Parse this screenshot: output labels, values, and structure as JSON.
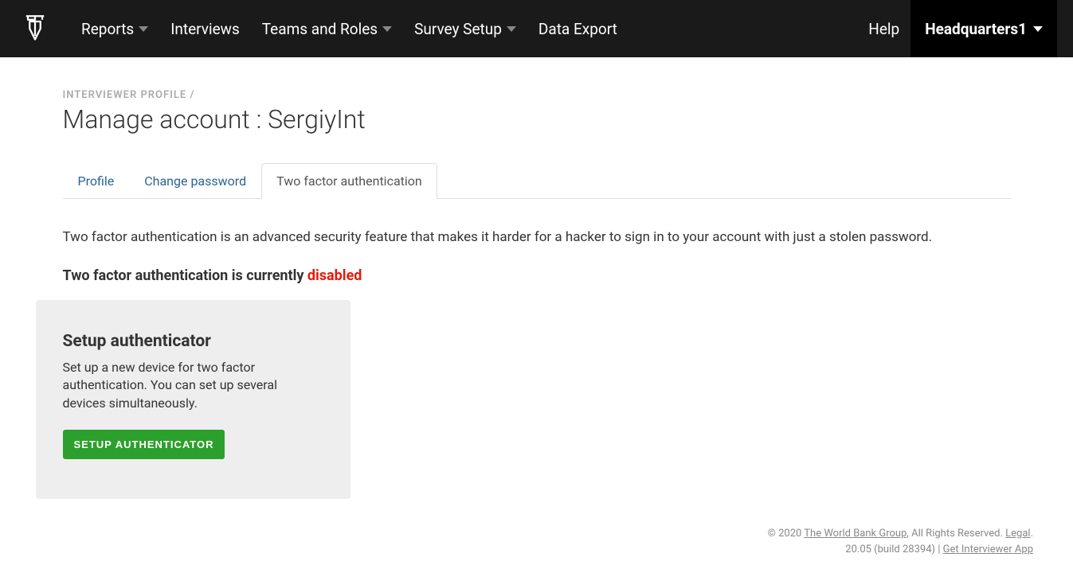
{
  "nav": {
    "items": [
      {
        "label": "Reports",
        "caret": true
      },
      {
        "label": "Interviews",
        "caret": false
      },
      {
        "label": "Teams and Roles",
        "caret": true
      },
      {
        "label": "Survey Setup",
        "caret": true
      },
      {
        "label": "Data Export",
        "caret": false
      }
    ],
    "help": "Help",
    "user": "Headquarters1"
  },
  "breadcrumb": "INTERVIEWER PROFILE /",
  "page_title_prefix": "Manage account : ",
  "page_title_name": "SergiyInt",
  "tabs": [
    {
      "label": "Profile",
      "active": false
    },
    {
      "label": "Change password",
      "active": false
    },
    {
      "label": "Two factor authentication",
      "active": true
    }
  ],
  "content": {
    "description": "Two factor authentication is an advanced security feature that makes it harder for a hacker to sign in to your account with just a stolen password.",
    "status_prefix": "Two factor authentication is currently ",
    "status_word": "disabled",
    "setup": {
      "title": "Setup authenticator",
      "text": "Set up a new device for two factor authentication. You can set up several devices simultaneously.",
      "button": "SETUP AUTHENTICATOR"
    }
  },
  "footer": {
    "copyright_prefix": "© 2020 ",
    "org": "The World Bank Group",
    "rights": ", All Rights Reserved. ",
    "legal": "Legal",
    "period": ".",
    "version": "20.05 (build 28394) | ",
    "app_link": "Get Interviewer App"
  }
}
